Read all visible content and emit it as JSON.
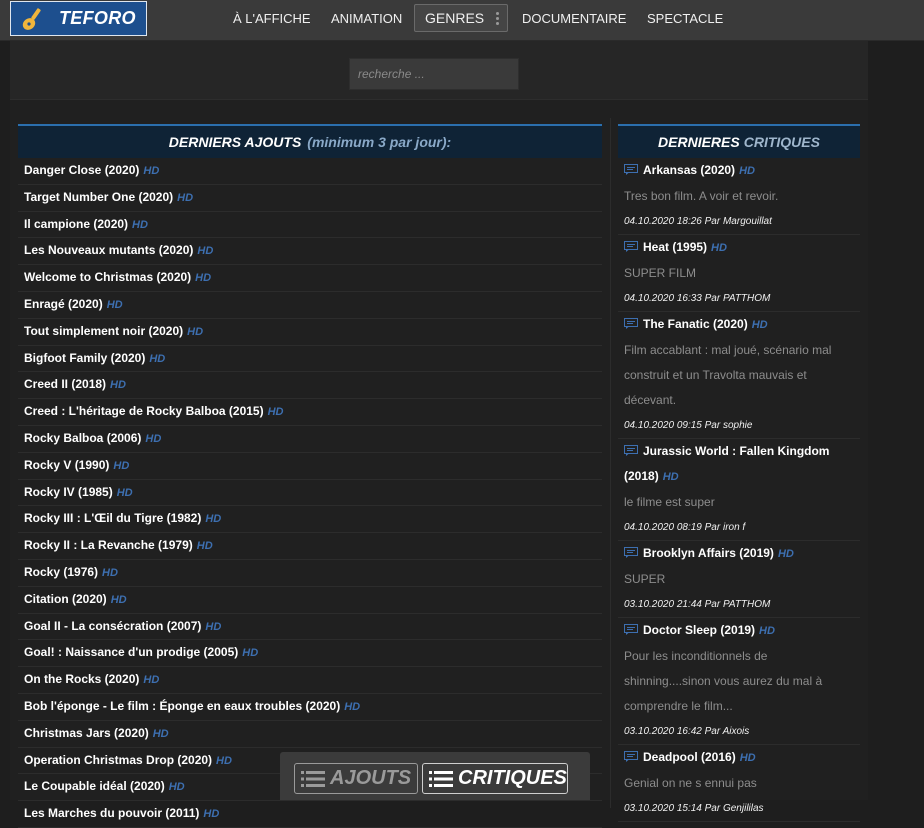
{
  "brand": {
    "name": "TEFORO"
  },
  "nav": {
    "items": [
      "À L'AFFICHE",
      "ANIMATION"
    ],
    "genres": "GENRES",
    "items2": [
      "DOCUMENTAIRE",
      "SPECTACLE"
    ]
  },
  "search": {
    "placeholder": "recherche ..."
  },
  "additions": {
    "title": "DERNIERS AJOUTS",
    "subtitle": "(minimum 3 par jour):",
    "hd_label": "HD",
    "items": [
      "Danger Close (2020)",
      "Target Number One (2020)",
      "Il campione (2020)",
      "Les Nouveaux mutants (2020)",
      "Welcome to Christmas (2020)",
      "Enragé (2020)",
      "Tout simplement noir (2020)",
      "Bigfoot Family (2020)",
      "Creed II (2018)",
      "Creed : L'héritage de Rocky Balboa (2015)",
      "Rocky Balboa (2006)",
      "Rocky V (1990)",
      "Rocky IV (1985)",
      "Rocky III : L'Œil du Tigre (1982)",
      "Rocky II : La Revanche (1979)",
      "Rocky (1976)",
      "Citation (2020)",
      "Goal II - La consécration (2007)",
      "Goal! : Naissance d'un prodige (2005)",
      "On the Rocks (2020)",
      "Bob l'éponge - Le film : Éponge en eaux troubles (2020)",
      "Christmas Jars (2020)",
      "Operation Christmas Drop (2020)",
      "Le Coupable idéal (2020)",
      "Les Marches du pouvoir (2011)"
    ]
  },
  "reviews": {
    "title": "DERNIERES",
    "title2": "CRITIQUES",
    "hd_label": "HD",
    "items": [
      {
        "title": "Arkansas (2020)",
        "text": "Tres bon film. A voir et revoir.",
        "meta": "04.10.2020 18:26 Par Margouillat"
      },
      {
        "title": "Heat (1995)",
        "text": "SUPER FILM",
        "meta": "04.10.2020 16:33 Par PATTHOM"
      },
      {
        "title": "The Fanatic (2020)",
        "text": "Film accablant : mal joué, scénario mal construit et un Travolta mauvais et décevant.",
        "meta": "04.10.2020 09:15 Par sophie"
      },
      {
        "title": "Jurassic World : Fallen Kingdom (2018)",
        "text": "le filme est super",
        "meta": "04.10.2020 08:19 Par iron f"
      },
      {
        "title": "Brooklyn Affairs (2019)",
        "text": "SUPER",
        "meta": "03.10.2020 21:44 Par PATTHOM"
      },
      {
        "title": "Doctor Sleep (2019)",
        "text": "Pour les inconditionnels de shinning....sinon vous aurez du mal à comprendre le film...",
        "meta": "03.10.2020 16:42 Par Aixois"
      },
      {
        "title": "Deadpool (2016)",
        "text": "Genial on ne s ennui pas",
        "meta": "03.10.2020 15:14 Par Genjililas"
      }
    ]
  },
  "toggle": {
    "ajouts": "AJOUTS",
    "critiques": "CRITIQUES"
  }
}
